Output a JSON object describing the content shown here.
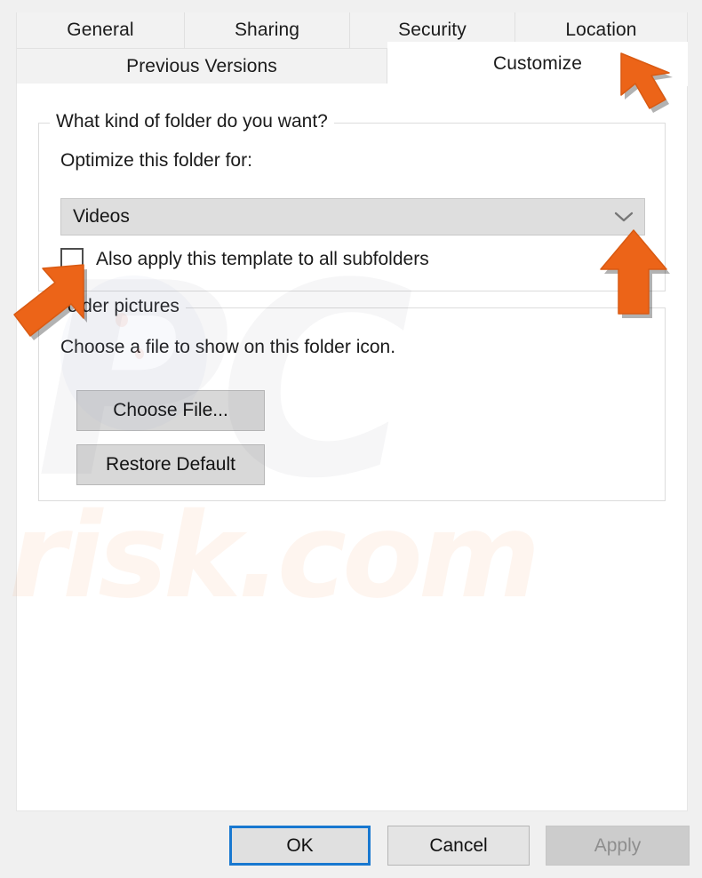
{
  "dialog": {
    "tabs_row1": [
      {
        "label": "General",
        "selected": false
      },
      {
        "label": "Sharing",
        "selected": false
      },
      {
        "label": "Security",
        "selected": false
      },
      {
        "label": "Location",
        "selected": false
      }
    ],
    "tabs_row2": [
      {
        "label": "Previous Versions",
        "selected": false
      },
      {
        "label": "Customize",
        "selected": true
      }
    ]
  },
  "folder_kind": {
    "group_title": "What kind of folder do you want?",
    "optimize_label": "Optimize this folder for:",
    "combo": {
      "value": "Videos",
      "arrow_icon": "chevron-down-icon"
    },
    "subfolders_checkbox": {
      "label": "Also apply this template to all subfolders",
      "checked": false
    }
  },
  "folder_pictures": {
    "group_title": "Folder pictures",
    "description": "Choose a file to show on this folder icon.",
    "choose_file_label": "Choose File...",
    "restore_default_label": "Restore Default"
  },
  "footer": {
    "ok_label": "OK",
    "cancel_label": "Cancel",
    "apply_label": "Apply",
    "apply_disabled": true
  },
  "watermark": {
    "logo_text": "PC",
    "site_text": "risk.com"
  },
  "annotations": {
    "arrow_color": "#ec6418",
    "arrows": [
      {
        "name": "arrow-pointing-customize-tab",
        "direction": "up-left"
      },
      {
        "name": "arrow-pointing-folder-type-combo",
        "direction": "up"
      },
      {
        "name": "arrow-pointing-subfolders-checkbox",
        "direction": "up-right"
      }
    ]
  },
  "colors": {
    "accent": "#ec6418",
    "focus_border": "#1878d0",
    "dialog_bg": "#f0f0f0",
    "panel_bg": "#ffffff",
    "button_bg": "#d8d8d8",
    "combo_bg": "#dedede"
  }
}
